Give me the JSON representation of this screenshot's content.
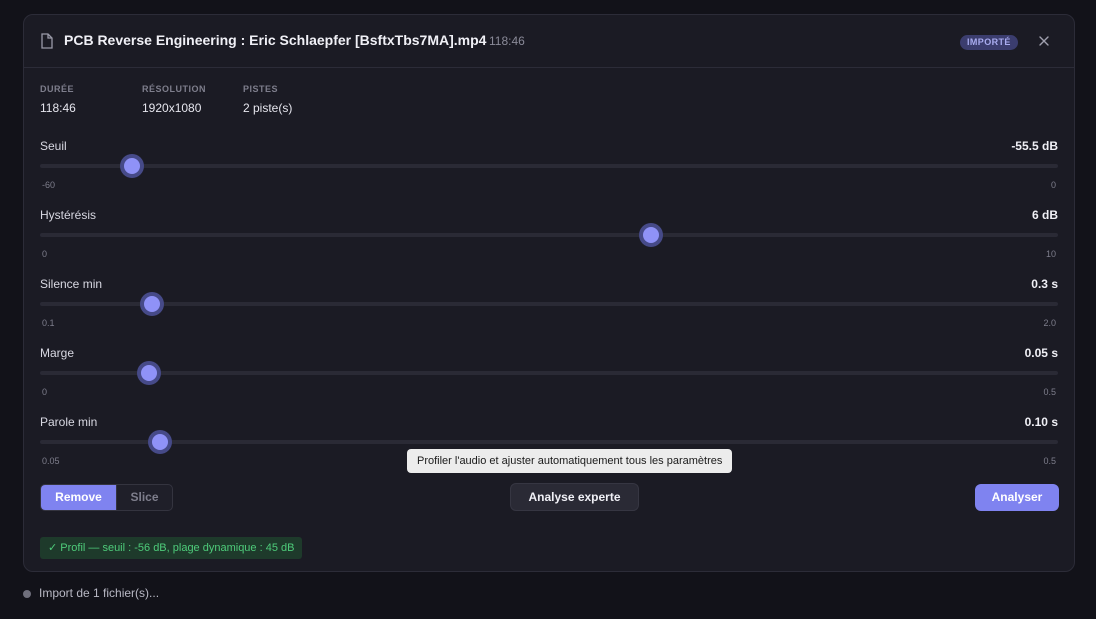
{
  "dialog": {
    "title": "PCB Reverse Engineering : Eric Schlaepfer [BsftxTbs7MA].mp4",
    "duration_short": "118:46",
    "badge": "IMPORTÉ"
  },
  "meta": [
    {
      "label": "DURÉE",
      "value": "118:46"
    },
    {
      "label": "RÉSOLUTION",
      "value": "1920x1080"
    },
    {
      "label": "PISTES",
      "value": "2 piste(s)"
    }
  ],
  "params": [
    {
      "label": "Seuil",
      "value": "-55.5 dB",
      "min": "-60",
      "max": "0",
      "level": 0.09
    },
    {
      "label": "Hystérésis",
      "value": "6 dB",
      "min": "0",
      "max": "10",
      "level": 0.6
    },
    {
      "label": "Silence min",
      "value": "0.3 s",
      "min": "0.1",
      "max": "2.0",
      "level": 0.11
    },
    {
      "label": "Marge",
      "value": "0.05 s",
      "min": "0",
      "max": "0.5",
      "level": 0.107
    },
    {
      "label": "Parole min",
      "value": "0.10 s",
      "min": "0.05",
      "max": "0.5",
      "level": 0.118
    }
  ],
  "tooltip": "Profiler l'audio et ajuster automatiquement tous les paramètres",
  "mode": {
    "options": [
      "Remove",
      "Slice"
    ],
    "selected": "Remove"
  },
  "buttons": {
    "expert": "Analyse experte",
    "analyze": "Analyser"
  },
  "profile": "✓ Profil — seuil : -56 dB, plage dynamique : 45 dB",
  "status": "Import de 1 fichier(s)...",
  "colors": {
    "accent": "#7f83f0",
    "success": "#4ecb7a",
    "background": "#121219",
    "panel": "#1b1b24"
  },
  "icons": {
    "file": "file-icon",
    "close": "close-icon",
    "status": "status-dot-icon"
  }
}
